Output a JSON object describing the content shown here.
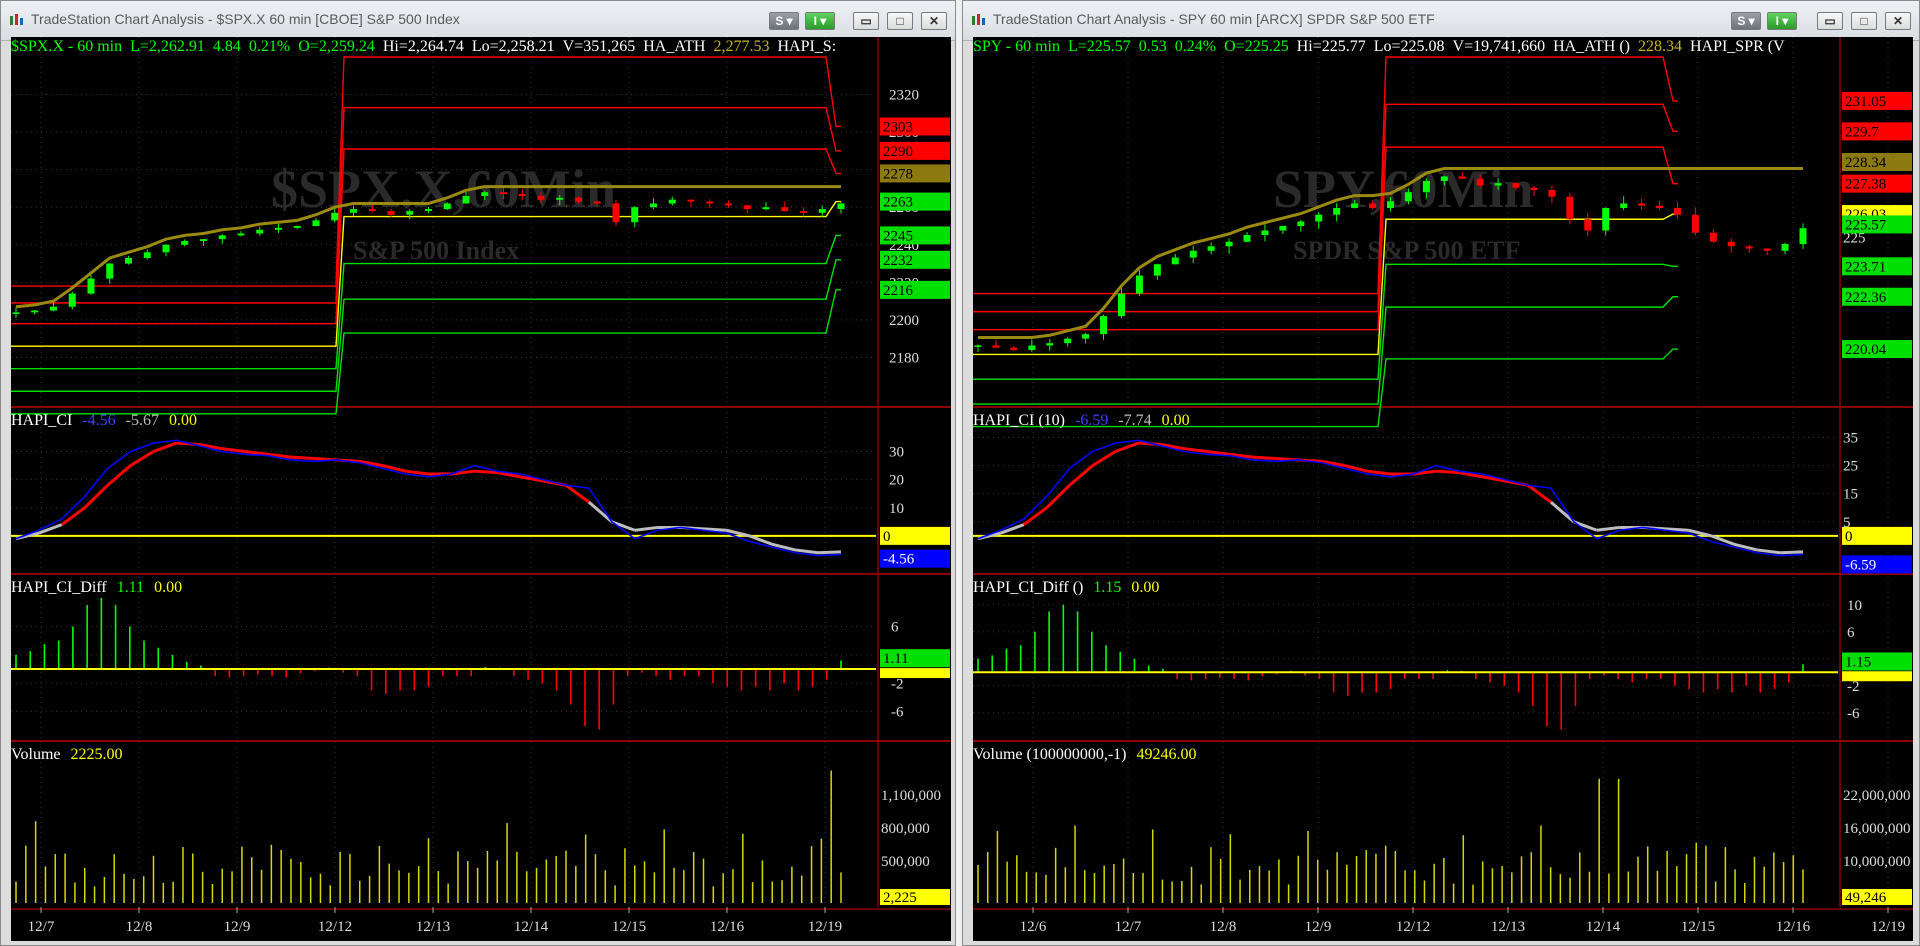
{
  "windows": [
    {
      "title": "TradeStation Chart Analysis - $SPX.X 60 min [CBOE] S&P 500 Index",
      "watermark": "$SPX.X,60Min",
      "watermark_sub": "S&P 500 Index",
      "header": {
        "symbol": "$SPX.X - 60 min",
        "last": "L=2,262.91",
        "change": "4.84",
        "pct": "0.21%",
        "open": "O=2,259.24",
        "high": "Hi=2,264.74",
        "low": "Lo=2,258.21",
        "vol": "V=351,265",
        "ind1": "HA_ATH",
        "ind1_val": "2,277.53",
        "ind2": "HAPI_S:"
      },
      "price_axis": [
        "2320",
        "2300",
        "2280",
        "2260",
        "2240",
        "2220",
        "2200",
        "2180"
      ],
      "price_tags": [
        {
          "text": "2303",
          "color": "#ff0000",
          "value": 2303
        },
        {
          "text": "2290",
          "color": "#ff0000",
          "value": 2290
        },
        {
          "text": "2278",
          "color": "#8b7a10",
          "value": 2278
        },
        {
          "text": "2263",
          "color": "#00e000",
          "value": 2263
        },
        {
          "text": "2245",
          "color": "#00e000",
          "value": 2245
        },
        {
          "text": "2232",
          "color": "#00e000",
          "value": 2232
        },
        {
          "text": "2216",
          "color": "#00e000",
          "value": 2216
        }
      ],
      "ci": {
        "label": "HAPI_CI",
        "v1": "-4.56",
        "v2": "-5.67",
        "v3": "0.00",
        "axis": [
          "30",
          "20",
          "10",
          "0"
        ],
        "tags": [
          {
            "text": "0",
            "color": "#ffff00",
            "value": 0
          },
          {
            "text": "-4.56",
            "color": "#0000ff",
            "value": -4.56
          }
        ]
      },
      "diff": {
        "label": "HAPI_CI_Diff",
        "v1": "1.11",
        "v2": "0.00",
        "axis": [
          "6",
          "2",
          "-2",
          "-6"
        ],
        "tags": [
          {
            "text": "1.11",
            "color": "#00e000",
            "value": 1.11
          },
          {
            "text": "0",
            "color": "#ffff00",
            "value": 0
          }
        ]
      },
      "volume": {
        "label": "Volume",
        "v1": "2225.00",
        "axis": [
          "1,100,000",
          "800,000",
          "500,000",
          "200,000"
        ],
        "tag": "2,225"
      },
      "dates": [
        "12/7",
        "12/8",
        "12/9",
        "12/12",
        "12/13",
        "12/14",
        "12/15",
        "12/16",
        "12/19"
      ]
    },
    {
      "title": "TradeStation Chart Analysis - SPY 60 min [ARCX] SPDR S&P 500 ETF",
      "watermark": "SPY,60Min",
      "watermark_sub": "SPDR S&P 500 ETF",
      "header": {
        "symbol": "SPY - 60 min",
        "last": "L=225.57",
        "change": "0.53",
        "pct": "0.24%",
        "open": "O=225.25",
        "high": "Hi=225.77",
        "low": "Lo=225.08",
        "vol": "V=19,741,660",
        "ind1": "HA_ATH ()",
        "ind1_val": "228.34",
        "ind2": "HAPI_SPR (V"
      },
      "price_axis": [
        "225"
      ],
      "price_tags": [
        {
          "text": "231.05",
          "color": "#ff0000",
          "value": 231.05
        },
        {
          "text": "229.7",
          "color": "#ff0000",
          "value": 229.7
        },
        {
          "text": "228.34",
          "color": "#8b7a10",
          "value": 228.34
        },
        {
          "text": "227.38",
          "color": "#ff0000",
          "value": 227.38
        },
        {
          "text": "226.03",
          "color": "#ffff00",
          "value": 226.03
        },
        {
          "text": "225.57",
          "color": "#00e000",
          "value": 225.57
        },
        {
          "text": "223.71",
          "color": "#00e000",
          "value": 223.71
        },
        {
          "text": "222.36",
          "color": "#00e000",
          "value": 222.36
        },
        {
          "text": "220.04",
          "color": "#00e000",
          "value": 220.04
        }
      ],
      "ci": {
        "label": "HAPI_CI (10)",
        "v1": "-6.59",
        "v2": "-7.74",
        "v3": "0.00",
        "axis": [
          "35",
          "25",
          "15",
          "5"
        ],
        "tags": [
          {
            "text": "0",
            "color": "#ffff00",
            "value": 0
          },
          {
            "text": "-6.59",
            "color": "#0000ff",
            "value": -6.59
          }
        ]
      },
      "diff": {
        "label": "HAPI_CI_Diff ()",
        "v1": "1.15",
        "v2": "0.00",
        "axis": [
          "10",
          "6",
          "2",
          "-2",
          "-6"
        ],
        "tags": [
          {
            "text": "1.15",
            "color": "#00e000",
            "value": 1.15
          },
          {
            "text": "0",
            "color": "#ffff00",
            "value": 0
          }
        ]
      },
      "volume": {
        "label": "Volume (100000000,-1)",
        "v1": "49246.00",
        "axis": [
          "22,000,000",
          "16,000,000",
          "10,000,000",
          "4,000,000"
        ],
        "tag": "49,246"
      },
      "dates": [
        "12/6",
        "12/7",
        "12/8",
        "12/9",
        "12/12",
        "12/13",
        "12/14",
        "12/15",
        "12/16",
        "12/19"
      ]
    }
  ],
  "chart_data": [
    {
      "type": "line",
      "title": "$SPX.X - 60 min",
      "ylim": [
        2160,
        2340
      ],
      "x": [
        "12/7",
        "12/8",
        "12/9",
        "12/12",
        "12/13",
        "12/14",
        "12/15",
        "12/16",
        "12/19"
      ],
      "series": [
        {
          "name": "HA_ATH",
          "values": [
            2208,
            2230,
            2250,
            2257,
            2270,
            2278,
            2278,
            2278,
            2277.53
          ]
        }
      ]
    },
    {
      "type": "line",
      "title": "SPY - 60 min",
      "ylim": [
        218,
        233
      ],
      "x": [
        "12/6",
        "12/7",
        "12/8",
        "12/9",
        "12/12",
        "12/13",
        "12/14",
        "12/15",
        "12/16",
        "12/19"
      ],
      "series": [
        {
          "name": "HA_ATH ()",
          "values": [
            220.5,
            221,
            223.5,
            225,
            225.5,
            227,
            228.34,
            228.34,
            228.34,
            228.34
          ]
        }
      ]
    }
  ],
  "colors": {
    "up": "#00ff00",
    "down": "#ff0000",
    "ha": "#9a8a10",
    "ci_fast": "#0000ff",
    "ci_slow": "#ff0000",
    "zero": "#ffff00",
    "vol": "#d8d800"
  }
}
